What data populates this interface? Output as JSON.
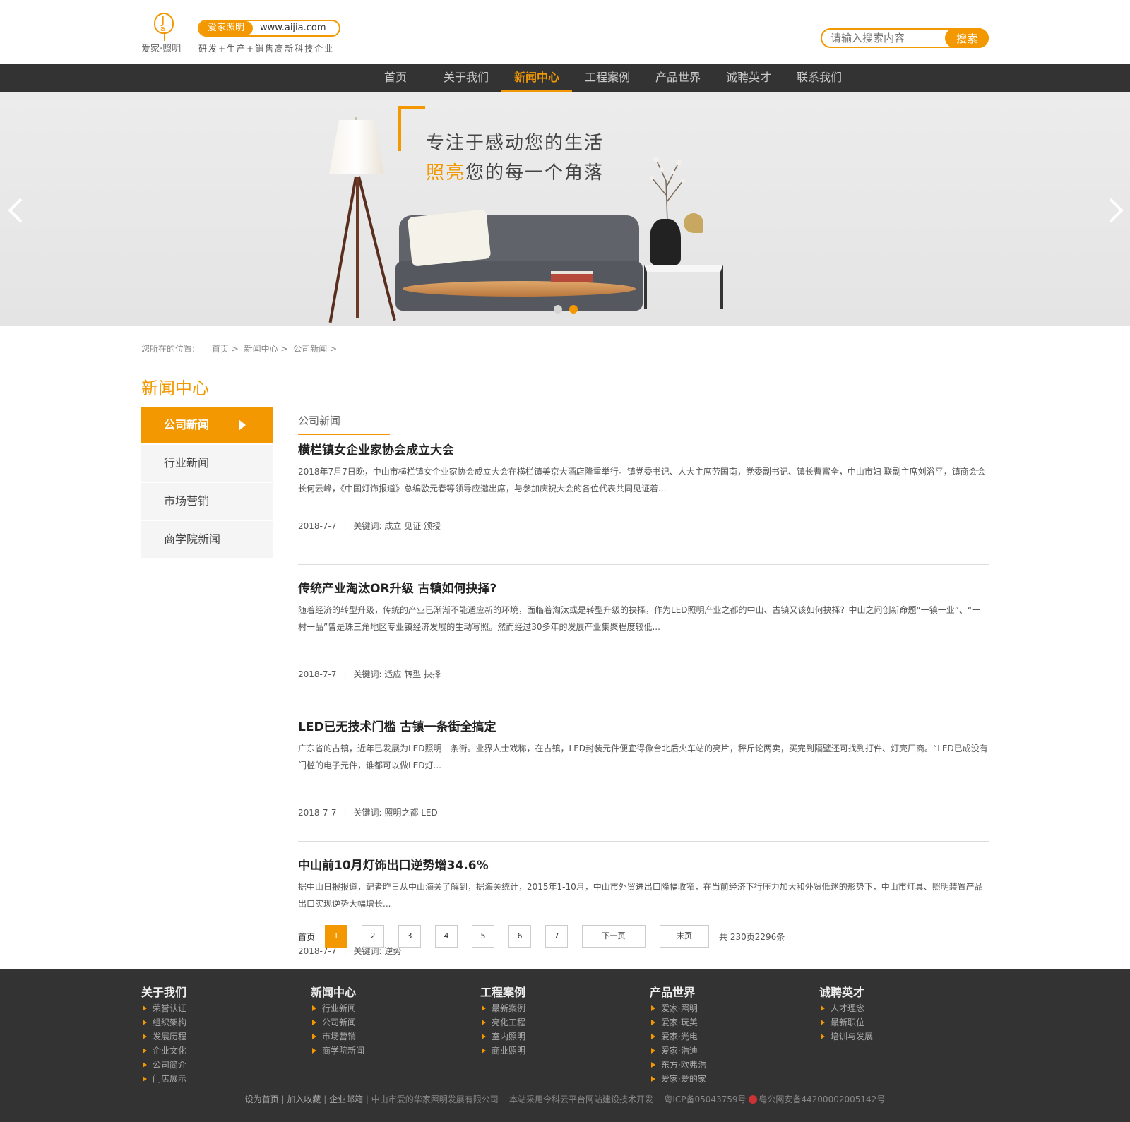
{
  "header": {
    "logo_text": "爱家·照明",
    "logo_mark_j": "j",
    "logo_mark_a": "a",
    "brand_label": "爱家照明",
    "url": "www.aijia.com",
    "slogan": "研发+生产+销售高新科技企业",
    "search_placeholder": "请输入搜索内容",
    "search_button": "搜索"
  },
  "nav": {
    "items": [
      "首页",
      "关于我们",
      "新闻中心",
      "工程案例",
      "产品世界",
      "诚聘英才",
      "联系我们"
    ],
    "active": "新闻中心"
  },
  "banner": {
    "line1": "专注于感动您的生活",
    "line2_highlight": "照亮",
    "line2_rest": "您的每一个角落",
    "slides": 2,
    "active_slide": 2
  },
  "breadcrumb": {
    "label": "您所在的位置:",
    "path": [
      "首页 >",
      "新闻中心 >",
      "公司新闻 >"
    ]
  },
  "section_title": "新闻中心",
  "sidebar": {
    "items": [
      "公司新闻",
      "行业新闻",
      "市场营销",
      "商学院新闻"
    ],
    "active": "公司新闻"
  },
  "list": {
    "tab_title": "公司新闻",
    "keyword_label": "关键词:",
    "articles": [
      {
        "title": "横栏镇女企业家协会成立大会",
        "summary": "2018年7月7日晚，中山市横栏镇女企业家协会成立大会在横栏镇美京大酒店隆重举行。镇党委书记、人大主席劳国南，党委副书记、镇长曹富全，中山市妇 联副主席刘浴平，镇商会会长何云峰，《中国灯饰报道》总编欧元春等领导应邀出席，与参加庆祝大会的各位代表共同见证着...",
        "date": "2018-7-7",
        "keywords": "成立 见证 颁授"
      },
      {
        "title": "传统产业淘汰OR升级 古镇如何抉择?",
        "summary": "随着经济的转型升级，传统的产业已渐渐不能适应新的环境，面临着淘汰或是转型升级的抉择，作为LED照明产业之都的中山、古镇又该如何抉择？中山之问创新命题“一镇一业”、“一村一品”曾是珠三角地区专业镇经济发展的生动写照。然而经过30多年的发展产业集聚程度较低...",
        "date": "2018-7-7",
        "keywords": "适应 转型 抉择"
      },
      {
        "title": "LED已无技术门槛 古镇一条街全搞定",
        "summary": "广东省的古镇，近年已发展为LED照明一条街。业界人士戏称，在古镇，LED封装元件便宜得像台北后火车站的亮片，秤斤论两卖，买完到隔壁还可找到打件、灯壳厂商。“LED已成没有门槛的电子元件，谁都可以做LED灯...",
        "date": "2018-7-7",
        "keywords": "照明之都 LED"
      },
      {
        "title": "中山前10月灯饰出口逆势增34.6%",
        "summary": "据中山日报报道，记者昨日从中山海关了解到，据海关统计，2015年1-10月，中山市外贸进出口降幅收窄，在当前经济下行压力加大和外贸低迷的形势下，中山市灯具、照明装置产品出口实现逆势大幅增长...",
        "date": "2018-7-7",
        "keywords": "逆势"
      }
    ]
  },
  "pagination": {
    "first": "首页",
    "pages": [
      "1",
      "2",
      "3",
      "4",
      "5",
      "6",
      "7"
    ],
    "active_page": "1",
    "next": "下一页",
    "last": "末页",
    "total": "共 230页2296条"
  },
  "footer": {
    "columns": [
      {
        "title": "关于我们",
        "links": [
          "荣誉认证",
          "组织架构",
          "发展历程",
          "企业文化",
          "公司简介",
          "门店展示"
        ]
      },
      {
        "title": "新闻中心",
        "links": [
          "行业新闻",
          "公司新闻",
          "市场营销",
          "商学院新闻"
        ]
      },
      {
        "title": "工程案例",
        "links": [
          "最新案例",
          "亮化工程",
          "室内照明",
          "商业照明"
        ]
      },
      {
        "title": "产品世界",
        "links": [
          "爱家·照明",
          "爱家·玩美",
          "爱家·光电",
          "爱家·浩迪",
          "东方·欧弗浩",
          "爱家·爱的家"
        ]
      },
      {
        "title": "诚聘英才",
        "links": [
          "人才理念",
          "最新职位",
          "培训与发展"
        ]
      }
    ],
    "bottom_links": [
      "设为首页",
      "加入收藏",
      "企业邮箱"
    ],
    "company": "中山市爱的华家照明发展有限公司",
    "tech": "本站采用今科云平台网站建设技术开发",
    "icp": "粤ICP备05043759号",
    "police": "粤公网安备44200002005142号"
  },
  "colors": {
    "accent": "#f39800",
    "nav_bg": "#333333",
    "footer_bg": "#333333"
  }
}
